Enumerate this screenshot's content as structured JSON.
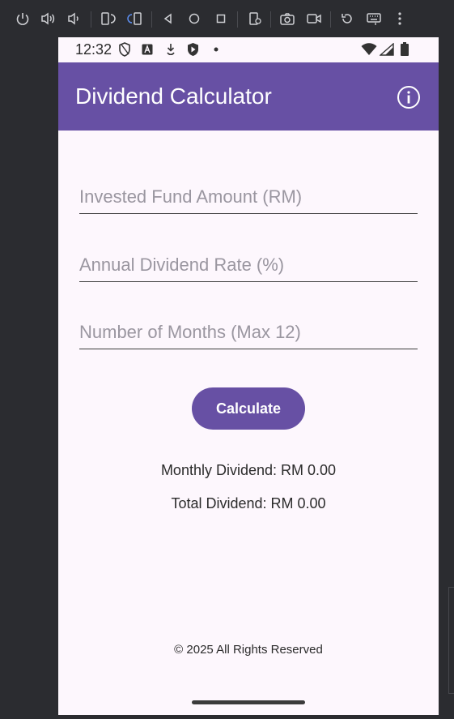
{
  "status_bar": {
    "time": "12:32"
  },
  "app_bar": {
    "title": "Dividend Calculator"
  },
  "form": {
    "invested_fund": {
      "value": "",
      "placeholder": "Invested Fund Amount (RM)"
    },
    "dividend_rate": {
      "value": "",
      "placeholder": "Annual Dividend Rate (%)"
    },
    "months": {
      "value": "",
      "placeholder": "Number of Months (Max 12)"
    }
  },
  "actions": {
    "calculate_label": "Calculate"
  },
  "results": {
    "monthly": "Monthly Dividend: RM 0.00",
    "total": "Total Dividend: RM 0.00"
  },
  "footer": {
    "text": "© 2025 All Rights Reserved"
  },
  "colors": {
    "primary": "#6750a4",
    "surface": "#fdf7fd",
    "emulator_bg": "#2b2c30"
  },
  "emulator_toolbar": {
    "icons": [
      "power-icon",
      "volume-up-icon",
      "volume-down-icon",
      "rotate-left-icon",
      "rotate-right-icon",
      "back-icon",
      "home-icon",
      "overview-icon",
      "fold-icon",
      "screenshot-icon",
      "screen-record-icon",
      "reset-icon",
      "keyboard-icon",
      "more-icon"
    ]
  }
}
